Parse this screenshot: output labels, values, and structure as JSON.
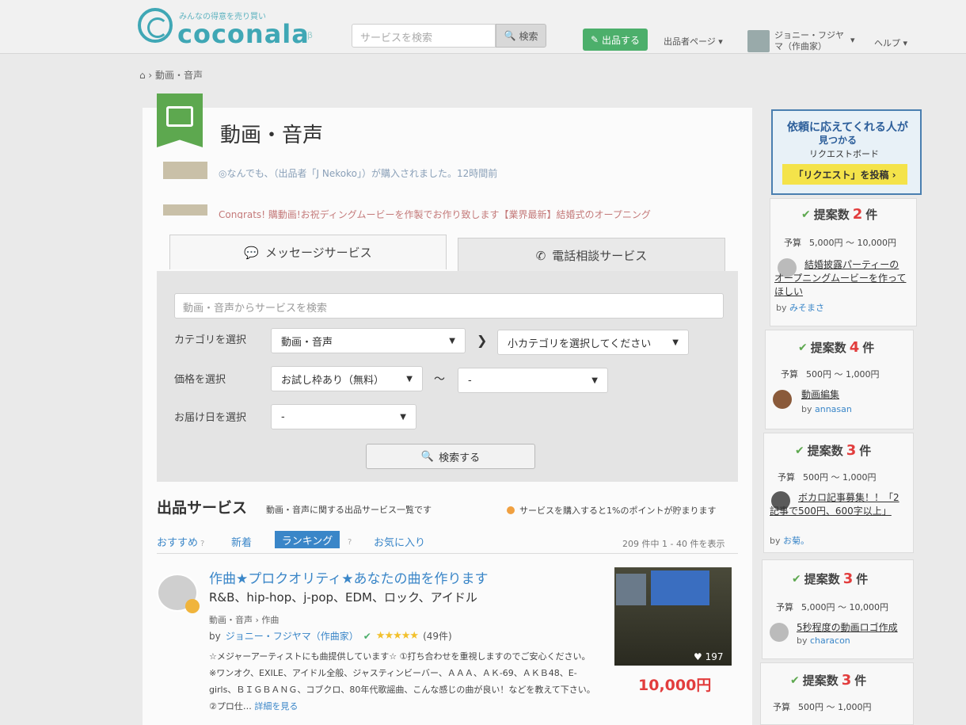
{
  "header": {
    "logo_tagline": "みんなの得意を売り買い",
    "logo_text": "coconala",
    "logo_badge": "β",
    "search_placeholder": "サービスを検索",
    "search_button": "検索",
    "sell_button": "出品する",
    "nav_seller_page": "出品者ページ ▾",
    "nav_user_name": "ジョニー・フジヤマ（作曲家）",
    "nav_user_arrow": "▾",
    "nav_help": "ヘルプ ▾"
  },
  "breadcrumb": "⌂ › 動画・音声",
  "category": {
    "title": "動画・音声",
    "ticker": [
      "◎なんでも、（出品者「J Nekoko」）が購入されました。12時間前",
      "Congrats! 購動画!お祝ディングムービーを作製でお作り致します【業界最新】結婚式のオープニング"
    ]
  },
  "tabs": {
    "message": "メッセージサービス",
    "phone": "電話相談サービス"
  },
  "search_panel": {
    "keyword_placeholder": "動画・音声からサービスを検索",
    "category_label": "カテゴリを選択",
    "category_value": "動画・音声",
    "subcategory_value": "小カテゴリを選択してください",
    "price_label": "価格を選択",
    "price_min": "お試し枠あり（無料）",
    "price_tilde": "～",
    "price_max": "-",
    "delivery_label": "お届け日を選択",
    "delivery_value": "-",
    "submit": "検索する"
  },
  "listing": {
    "title": "出品サービス",
    "subtitle": "動画・音声に関する出品サービス一覧です",
    "points_note": "サービスを購入すると1%のポイントが貯まります",
    "sort": {
      "recommended": "おすすめ",
      "new": "新着",
      "ranking": "ランキング",
      "favorites": "お気に入り"
    },
    "result_count": "209 件中 1 - 40 件を表示",
    "items": [
      {
        "title": "作曲★プロクオリティ★あなたの曲を作ります",
        "tags": "R&B、hip-hop、j-pop、EDM、ロック、アイドル",
        "crumb": "動画・音声 › 作曲",
        "by": "by",
        "seller": "ジョニー・フジヤマ（作曲家）",
        "rating_count": "(49件)",
        "description": "☆メジャーアーティストにも曲提供しています☆ ①打ち合わせを重視しますのでご安心ください。 ※ワンオク、EXILE、アイドル全般、ジャスティンビーバー、ＡＡＡ、ＡＫ-69、ＡＫＢ48、E-girls、ＢＩＧＢＡＮＧ、コブクロ、80年代歌謡曲、こんな感じの曲が良い！などを教えて下さい。 ②プロ仕…",
        "more": "詳細を見る",
        "likes": "♥ 197",
        "price": "10,000円"
      }
    ]
  },
  "sidebar": {
    "banner": {
      "line1": "依頼に応えてくれる人が",
      "line2": "見つかる",
      "line3": "リクエストボード",
      "button": "「リクエスト」を投稿 ›"
    },
    "requests": [
      {
        "count_label": "提案数",
        "count": "2",
        "unit": "件",
        "budget_label": "予算",
        "budget": "5,000円 ～ 10,000円",
        "title": "結婚披露パーティーのオープニングムービーを作ってほしい",
        "by": "by",
        "user": "みそまさ"
      },
      {
        "count_label": "提案数",
        "count": "4",
        "unit": "件",
        "budget_label": "予算",
        "budget": "500円 ～ 1,000円",
        "title": "動画編集",
        "by": "by",
        "user": "annasan"
      },
      {
        "count_label": "提案数",
        "count": "3",
        "unit": "件",
        "budget_label": "予算",
        "budget": "500円 ～ 1,000円",
        "title": "ボカロ記事募集！！「2記事で500円、600字以上」",
        "by": "by",
        "user": "お菊。"
      },
      {
        "count_label": "提案数",
        "count": "3",
        "unit": "件",
        "budget_label": "予算",
        "budget": "5,000円 ～ 10,000円",
        "title": "5秒程度の動画ロゴ作成",
        "by": "by",
        "user": "characon"
      },
      {
        "count_label": "提案数",
        "count": "3",
        "unit": "件",
        "budget_label": "予算",
        "budget": "500円 ～ 1,000円"
      }
    ]
  }
}
